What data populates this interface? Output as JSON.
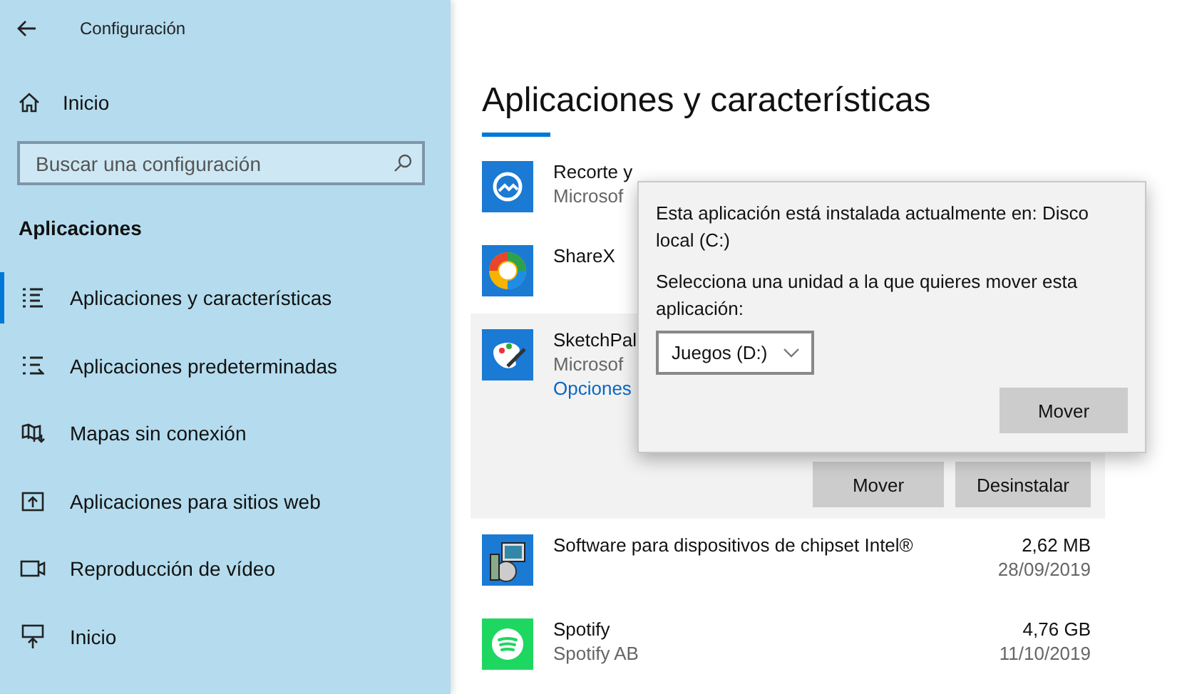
{
  "window": {
    "title": "Configuración"
  },
  "sidebar": {
    "home": "Inicio",
    "search": {
      "placeholder": "Buscar una configuración"
    },
    "section": "Aplicaciones",
    "items": [
      {
        "label": "Aplicaciones y características",
        "selected": true
      },
      {
        "label": "Aplicaciones predeterminadas",
        "selected": false
      },
      {
        "label": "Mapas sin conexión",
        "selected": false
      },
      {
        "label": "Aplicaciones para sitios web",
        "selected": false
      },
      {
        "label": "Reproducción de vídeo",
        "selected": false
      },
      {
        "label": "Inicio",
        "selected": false
      }
    ]
  },
  "main": {
    "title": "Aplicaciones y características",
    "apps": [
      {
        "name": "Recorte y",
        "publisher": "Microsof",
        "expanded": false
      },
      {
        "name": "ShareX",
        "expanded": false
      },
      {
        "name": "SketchPal",
        "publisher": "Microsof",
        "link": "Opciones",
        "expanded": true,
        "buttons": [
          "Mover",
          "Desinstalar"
        ]
      },
      {
        "name": "Software para dispositivos de chipset Intel®",
        "size": "2,62 MB",
        "date": "28/09/2019",
        "expanded": false
      },
      {
        "name": "Spotify",
        "publisher": "Spotify AB",
        "size": "4,76 GB",
        "date": "11/10/2019",
        "expanded": false
      }
    ]
  },
  "popup": {
    "message": "Esta aplicación está instalada actualmente en: Disco local (C:)",
    "prompt": "Selecciona una unidad a la que quieres mover esta aplicación:",
    "drive": "Juegos (D:)",
    "button": "Mover"
  }
}
